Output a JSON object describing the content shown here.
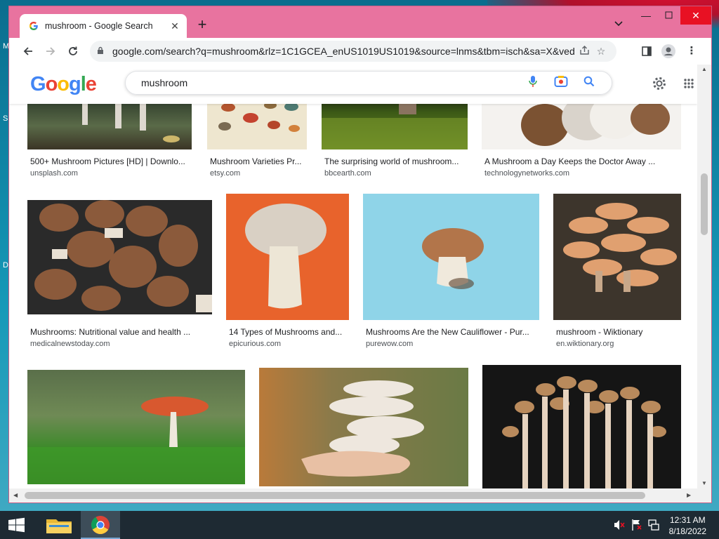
{
  "desktop": {
    "labels": [
      "M",
      "S",
      "D"
    ]
  },
  "browser": {
    "tab_title": "mushroom - Google Search",
    "url": "google.com/search?q=mushroom&rlz=1C1GCEA_enUS1019US1019&source=lnms&tbm=isch&sa=X&ved..."
  },
  "google": {
    "logo": [
      "G",
      "o",
      "o",
      "g",
      "l",
      "e"
    ],
    "query": "mushroom"
  },
  "results": [
    {
      "caption": "500+ Mushroom Pictures [HD] | Downlo...",
      "source": "unsplash.com"
    },
    {
      "caption": "Mushroom Varieties Pr...",
      "source": "etsy.com"
    },
    {
      "caption": "The surprising world of mushroom...",
      "source": "bbcearth.com"
    },
    {
      "caption": "A Mushroom a Day Keeps the Doctor Away ...",
      "source": "technologynetworks.com"
    },
    {
      "caption": "Mushrooms: Nutritional value and health ...",
      "source": "medicalnewstoday.com"
    },
    {
      "caption": "14 Types of Mushrooms and...",
      "source": "epicurious.com"
    },
    {
      "caption": "Mushrooms Are the New Cauliflower - Pur...",
      "source": "purewow.com"
    },
    {
      "caption": "mushroom - Wiktionary",
      "source": "en.wiktionary.org"
    }
  ],
  "taskbar": {
    "time": "12:31 AM",
    "date": "8/18/2022"
  },
  "colors": {
    "window_frame": "#e8739f",
    "google_blue": "#4285f4",
    "google_red": "#ea4335",
    "google_yellow": "#fbbc05",
    "google_green": "#34a853"
  }
}
